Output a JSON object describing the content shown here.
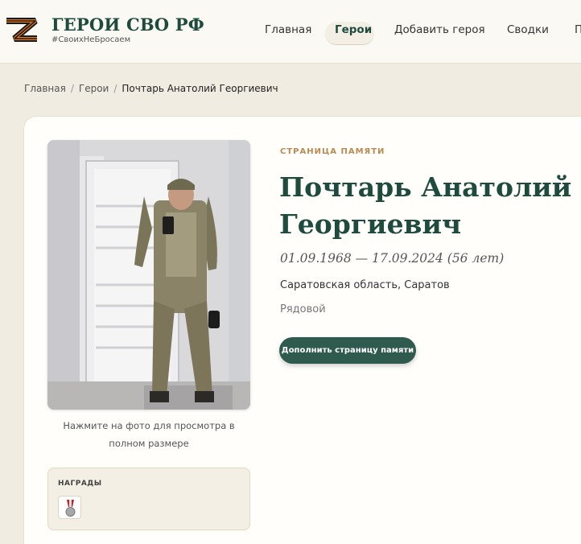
{
  "header": {
    "logo_icon": "z-ribbon-icon",
    "brand_title": "ГЕРОИ СВО РФ",
    "brand_tag": "#СвоихНеБросаем",
    "nav": [
      {
        "label": "Главная",
        "active": false
      },
      {
        "label": "Герои",
        "active": true
      },
      {
        "label": "Добавить героя",
        "active": false
      },
      {
        "label": "Сводки",
        "active": false
      },
      {
        "label": "П",
        "active": false
      }
    ]
  },
  "breadcrumb": {
    "items": [
      "Главная",
      "Герои"
    ],
    "separator": "/",
    "current": "Почтарь Анатолий Георгиевич"
  },
  "hero": {
    "kicker": "СТРАНИЦА ПАМЯТИ",
    "name_line1": "Почтарь Анатолий",
    "name_line2": "Георгиевич",
    "dates": "01.09.1968 — 17.09.2024 (56 лет)",
    "location": "Саратовская область, Саратов",
    "rank": "Рядовой",
    "add_button": "Дополнить страницу памяти"
  },
  "photo": {
    "caption": "Нажмите на фото для просмотра в полном размере"
  },
  "awards": {
    "title": "НАГРАДЫ",
    "items": [
      {
        "icon": "medal-icon"
      }
    ]
  },
  "colors": {
    "brand_green": "#1f4a3e",
    "button_green": "#2f5b4e",
    "accent_gold": "#b88a52",
    "page_bg": "#f1ece1"
  }
}
